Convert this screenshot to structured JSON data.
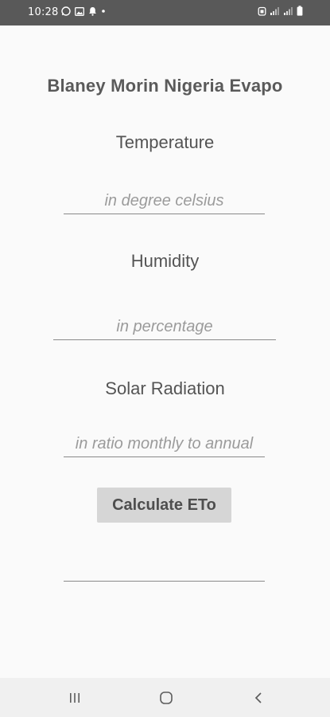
{
  "status_bar": {
    "time": "10:28",
    "left_icons": [
      "whatsapp-icon",
      "image-icon",
      "notification-bell-icon",
      "dot-icon"
    ],
    "right_icons": [
      "alarm-icon",
      "signal-icon",
      "signal-icon",
      "battery-icon"
    ]
  },
  "app": {
    "title": "Blaney Morin Nigeria Evapo"
  },
  "form": {
    "temperature_label": "Temperature",
    "temperature_placeholder": "in degree celsius",
    "humidity_label": "Humidity",
    "humidity_placeholder": "in percentage",
    "solar_label": "Solar Radiation",
    "solar_placeholder": "in ratio monthly to annual",
    "calculate_label": "Calculate ETo",
    "result_value": ""
  },
  "nav_bar": {
    "buttons": [
      "recent-apps-icon",
      "home-icon",
      "back-icon"
    ]
  }
}
